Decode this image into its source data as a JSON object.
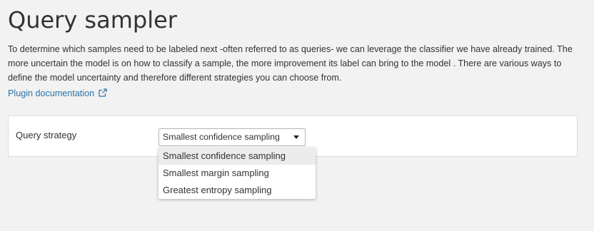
{
  "page": {
    "title": "Query sampler",
    "description": "To determine which samples need to be labeled next -often referred to as queries- we can leverage the classifier we have already trained. The more uncertain the model is on how to classify a sample, the more improvement its label can bring to the model . There are various ways to define the model uncertainty and therefore different strategies you can choose from.",
    "doc_link": {
      "label": "Plugin documentation",
      "icon": "external-link-icon"
    }
  },
  "form": {
    "query_strategy": {
      "label": "Query strategy",
      "selected": "Smallest confidence sampling",
      "dropdown_icon": "caret-down-icon",
      "options": [
        "Smallest confidence sampling",
        "Smallest margin sampling",
        "Greatest entropy sampling"
      ],
      "highlighted_index": 0
    }
  },
  "colors": {
    "background": "#f2f2f2",
    "link": "#2b73a8",
    "text": "#333333",
    "panel": "#ffffff",
    "highlight": "#ececec"
  }
}
